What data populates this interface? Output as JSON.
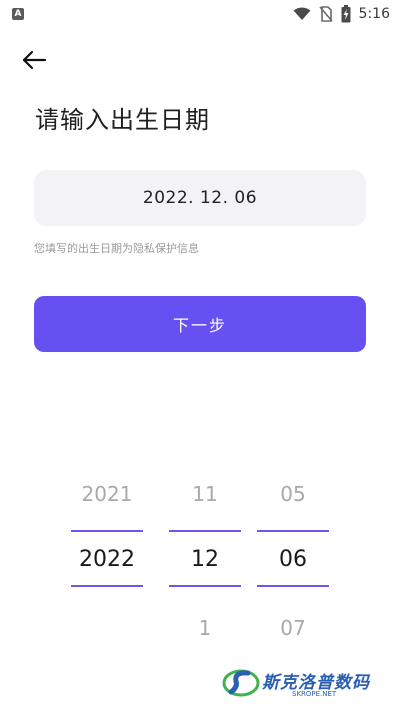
{
  "status_bar": {
    "left_icon": "A",
    "time": "5:16",
    "icons": [
      "wifi-icon",
      "no-sim-icon",
      "battery-charging-icon"
    ]
  },
  "header": {
    "back_icon": "arrow-left-icon",
    "title": "请输入出生日期"
  },
  "date_field": {
    "value": "2022. 12. 06"
  },
  "privacy_note": "您填写的出生日期为隐私保护信息",
  "next_button": {
    "label": "下一步",
    "color": "#6551f2"
  },
  "picker": {
    "year": {
      "prev": "2021",
      "selected": "2022",
      "next": ""
    },
    "month": {
      "prev": "11",
      "selected": "12",
      "next": "1"
    },
    "day": {
      "prev": "05",
      "selected": "06",
      "next": "07"
    },
    "accent": "#6b57f0"
  },
  "watermark": {
    "text": "斯克洛普数码",
    "sub": "SKROPE.NET"
  }
}
